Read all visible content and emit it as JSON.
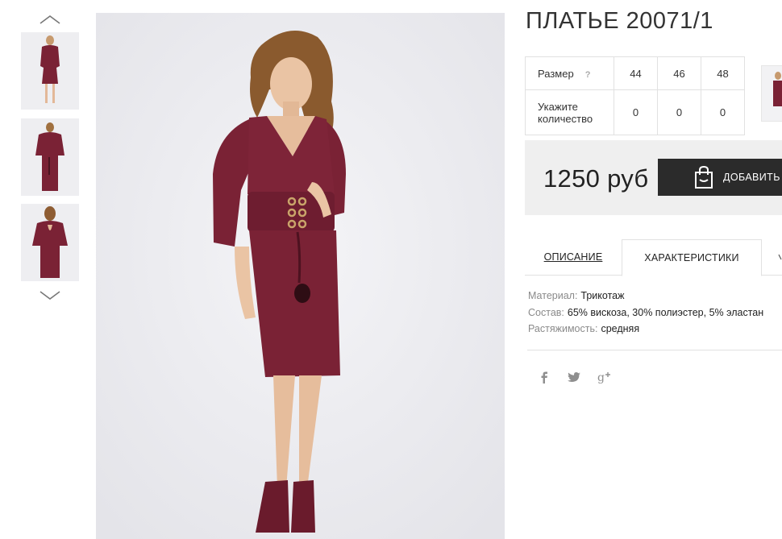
{
  "product": {
    "title": "ПЛАТЬЕ 20071/1",
    "price": "1250 руб",
    "add_to_cart_label": "ДОБАВИТЬ В",
    "dress_color": "#7a2235"
  },
  "gallery": {
    "up_icon": "chevron-up-icon",
    "down_icon": "chevron-down-icon",
    "thumbnails": [
      "front-view",
      "side-view",
      "back-view"
    ]
  },
  "sizes": {
    "size_label": "Размер",
    "help_mark": "?",
    "quantity_label_line1": "Укажите",
    "quantity_label_line2": "количество",
    "options": [
      {
        "size": "44",
        "qty": "0"
      },
      {
        "size": "46",
        "qty": "0"
      },
      {
        "size": "48",
        "qty": "0"
      }
    ]
  },
  "tabs": [
    {
      "label": "ОПИСАНИЕ",
      "active": false
    },
    {
      "label": "ХАРАКТЕРИСТИКИ",
      "active": true
    }
  ],
  "specs": [
    {
      "key": "Материал:",
      "value": "Трикотаж"
    },
    {
      "key": "Состав:",
      "value": "65% вискоза, 30% полиэстер, 5% эластан"
    },
    {
      "key": "Растяжимость:",
      "value": "средняя"
    }
  ],
  "social": [
    {
      "icon": "facebook-icon",
      "glyph": "f"
    },
    {
      "icon": "twitter-icon",
      "glyph": "t"
    },
    {
      "icon": "google-plus-icon",
      "glyph": "g+"
    }
  ]
}
